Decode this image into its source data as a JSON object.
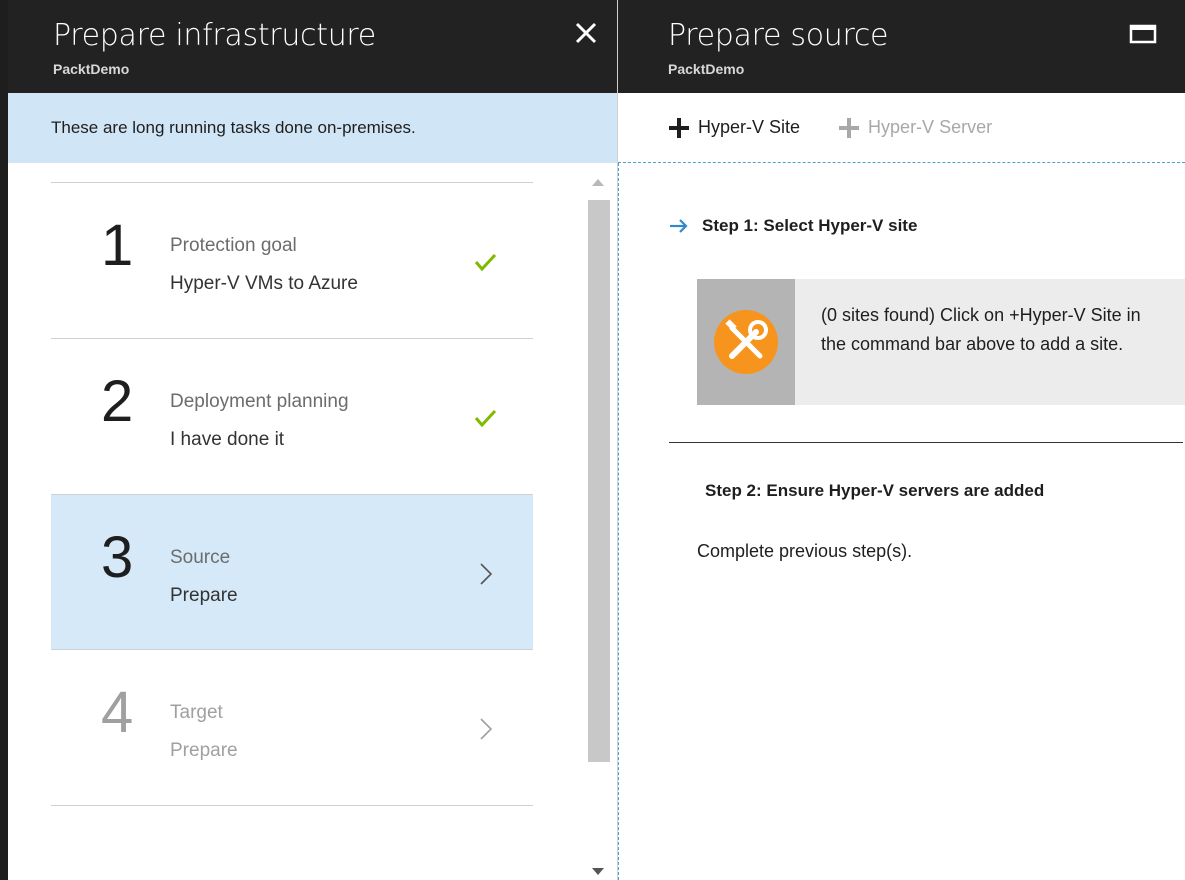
{
  "left_blade": {
    "title": "Prepare infrastructure",
    "subtitle": "PacktDemo",
    "banner": "These are long running tasks done on-premises.",
    "steps": [
      {
        "number": "1",
        "name": "Protection goal",
        "value": "Hyper-V VMs to Azure",
        "status": "check-icon"
      },
      {
        "number": "2",
        "name": "Deployment planning",
        "value": "I have done it",
        "status": "check-icon"
      },
      {
        "number": "3",
        "name": "Source",
        "value": "Prepare",
        "status": "chevron-right-icon"
      },
      {
        "number": "4",
        "name": "Target",
        "value": "Prepare",
        "status": "chevron-right-icon"
      }
    ]
  },
  "right_blade": {
    "title": "Prepare source",
    "subtitle": "PacktDemo",
    "commands": [
      {
        "label": "Hyper-V Site",
        "enabled": true
      },
      {
        "label": "Hyper-V Server",
        "enabled": false
      }
    ],
    "step1_heading": "Step 1: Select Hyper-V site",
    "step1_message": "(0 sites found) Click on +Hyper-V Site in the command bar above to add a site.",
    "step2_heading": "Step 2: Ensure Hyper-V servers are added",
    "step2_message": "Complete previous step(s)."
  },
  "colors": {
    "header_bg": "#222222",
    "banner_bg": "#d0e6f7",
    "active_step_bg": "#d5e9f8",
    "check_green": "#7fba00",
    "accent_orange": "#f7941d",
    "link_blue": "#2f8ac7"
  }
}
